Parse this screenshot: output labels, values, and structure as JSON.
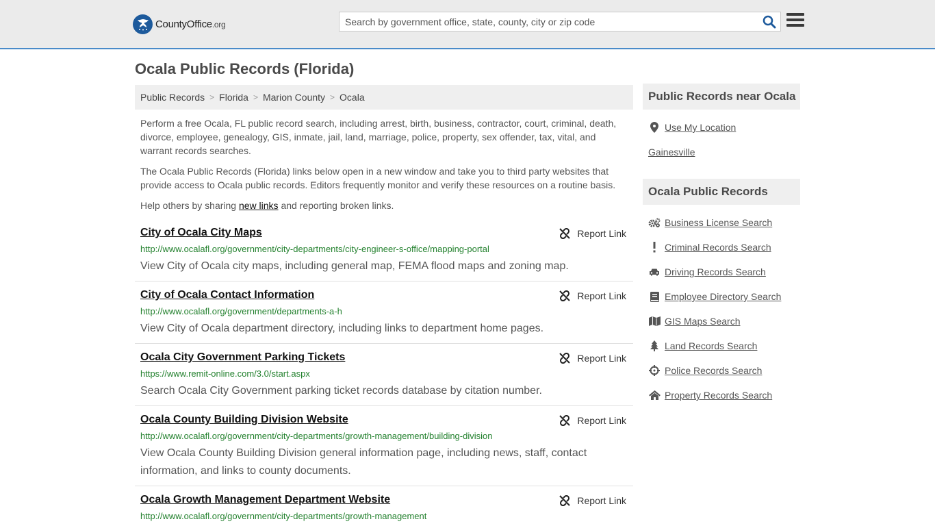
{
  "header": {
    "logo_name": "CountyOffice",
    "logo_tld": ".org",
    "search_placeholder": "Search by government office, state, county, city or zip code",
    "search_value": ""
  },
  "page_title": "Ocala Public Records (Florida)",
  "breadcrumb": [
    "Public Records",
    "Florida",
    "Marion County",
    "Ocala"
  ],
  "intro": {
    "p1": "Perform a free Ocala, FL public record search, including arrest, birth, business, contractor, court, criminal, death, divorce, employee, genealogy, GIS, inmate, jail, land, marriage, police, property, sex offender, tax, vital, and warrant records searches.",
    "p2": "The Ocala Public Records (Florida) links below open in a new window and take you to third party websites that provide access to Ocala public records. Editors frequently monitor and verify these resources on a routine basis.",
    "p3_before": "Help others by sharing ",
    "p3_link": "new links",
    "p3_after": " and reporting broken links."
  },
  "report_label": "Report Link",
  "results": [
    {
      "title": "City of Ocala City Maps",
      "url": "http://www.ocalafl.org/government/city-departments/city-engineer-s-office/mapping-portal",
      "desc": "View City of Ocala city maps, including general map, FEMA flood maps and zoning map."
    },
    {
      "title": "City of Ocala Contact Information",
      "url": "http://www.ocalafl.org/government/departments-a-h",
      "desc": "View City of Ocala department directory, including links to department home pages."
    },
    {
      "title": "Ocala City Government Parking Tickets",
      "url": "https://www.remit-online.com/3.0/start.aspx",
      "desc": "Search Ocala City Government parking ticket records database by citation number."
    },
    {
      "title": "Ocala County Building Division Website",
      "url": "http://www.ocalafl.org/government/city-departments/growth-management/building-division",
      "desc": "View Ocala County Building Division general information page, including news, staff, contact information, and links to county documents."
    },
    {
      "title": "Ocala Growth Management Department Website",
      "url": "http://www.ocalafl.org/government/city-departments/growth-management",
      "desc": ""
    }
  ],
  "sidebar": {
    "near_title": "Public Records near Ocala",
    "use_location": "Use My Location",
    "near_cities": [
      "Gainesville"
    ],
    "records_title": "Ocala Public Records",
    "records": [
      {
        "label": "Business License Search",
        "icon": "gears-icon"
      },
      {
        "label": "Criminal Records Search",
        "icon": "exclamation-icon"
      },
      {
        "label": "Driving Records Search",
        "icon": "car-icon"
      },
      {
        "label": "Employee Directory Search",
        "icon": "book-icon"
      },
      {
        "label": "GIS Maps Search",
        "icon": "map-icon"
      },
      {
        "label": "Land Records Search",
        "icon": "tree-icon"
      },
      {
        "label": "Police Records Search",
        "icon": "crosshairs-icon"
      },
      {
        "label": "Property Records Search",
        "icon": "home-icon"
      }
    ]
  },
  "colors": {
    "header_bg": "#ebebeb",
    "header_border": "#4a8bc9",
    "logo_blue": "#1d5a9c",
    "url_green": "#23812e",
    "panel_bg": "#efefef"
  }
}
